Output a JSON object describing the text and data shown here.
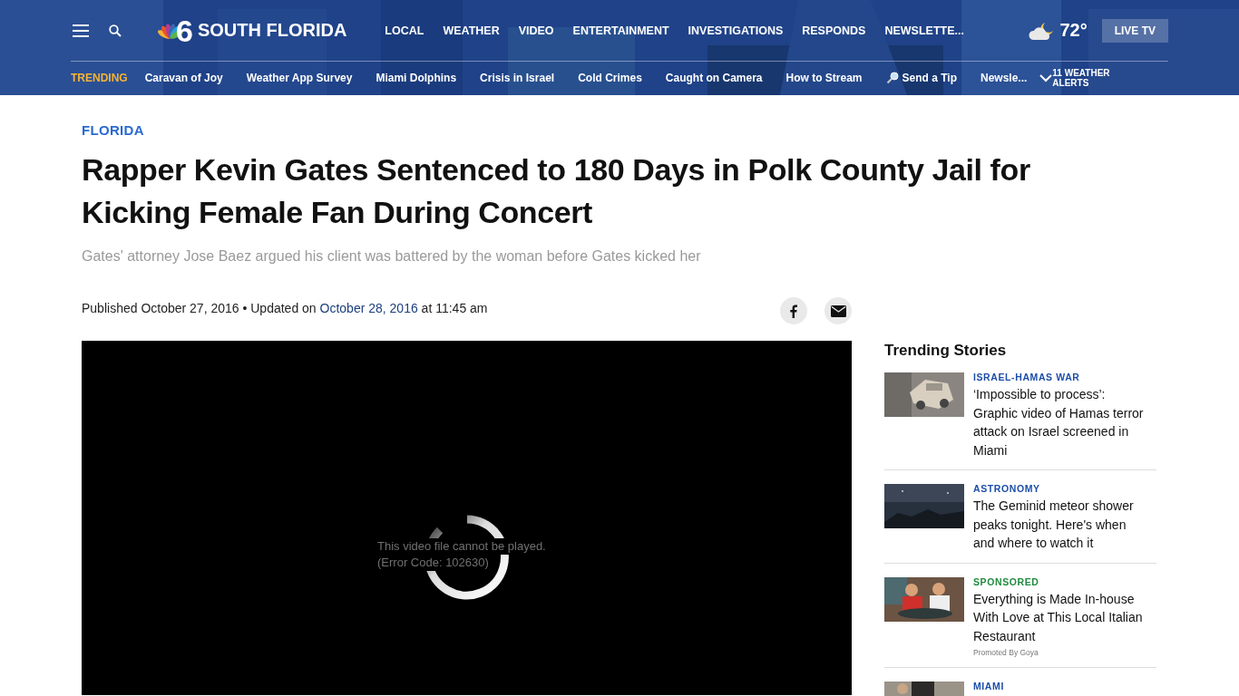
{
  "header": {
    "logo": {
      "mark": "6",
      "name": "SOUTH FLORIDA"
    },
    "nav": [
      "LOCAL",
      "WEATHER",
      "VIDEO",
      "ENTERTAINMENT",
      "INVESTIGATIONS",
      "RESPONDS",
      "NEWSLETTE..."
    ],
    "weather": {
      "temperature": "72°"
    },
    "live_button": "LIVE TV",
    "trending_label": "TRENDING",
    "trending": [
      {
        "kind": "link",
        "label": "Caravan of Joy"
      },
      {
        "kind": "link",
        "label": "Weather App Survey"
      },
      {
        "kind": "link",
        "label": "Miami Dolphins"
      },
      {
        "kind": "link",
        "label": "Crisis in Israel"
      },
      {
        "kind": "link",
        "label": "Cold Crimes"
      },
      {
        "kind": "link",
        "label": "Caught on Camera"
      },
      {
        "kind": "link",
        "label": "How to Stream"
      },
      {
        "kind": "tip",
        "label": "Send a Tip"
      },
      {
        "kind": "link",
        "label": "Newsle..."
      }
    ],
    "alerts": {
      "expanded": false,
      "label": "11 WEATHER ALERTS"
    }
  },
  "article": {
    "category": "FLORIDA",
    "headline": "Rapper Kevin Gates Sentenced to 180 Days in Polk County Jail for Kicking Female Fan During Concert",
    "dek": "Gates' attorney Jose Baez argued his client was battered by the woman before Gates kicked her",
    "meta": {
      "published_label": "Published",
      "published_date": "October 27, 2016",
      "separator": "•",
      "updated_label": "Updated on",
      "updated_date": "October 28, 2016",
      "updated_time": "at 11:45 am"
    },
    "share": [
      {
        "kind": "facebook"
      },
      {
        "kind": "email"
      }
    ],
    "video": {
      "error_lines": [
        "This video file cannot be played.",
        "(Error Code: 102630)"
      ]
    }
  },
  "sidebar": {
    "title": "Trending Stories",
    "stories": [
      {
        "category": "ISRAEL-HAMAS WAR",
        "color": "#1c4ea8",
        "title": "‘Impossible to process’: Graphic video of Hamas terror attack on Israel screened in Miami",
        "kind": "picture"
      },
      {
        "category": "ASTRONOMY",
        "color": "#1c4ea8",
        "title": "The Geminid meteor shower peaks tonight. Here's when and where to watch it",
        "kind": "picture"
      },
      {
        "category": "SPONSORED",
        "color": "#1f8a3e",
        "title": "Everything is Made In-house With Love at This Local Italian Restaurant",
        "promoted": "Promoted By Goya",
        "kind": "picture"
      },
      {
        "category": "MIAMI",
        "color": "#1c4ea8",
        "kind": "picture"
      }
    ]
  }
}
